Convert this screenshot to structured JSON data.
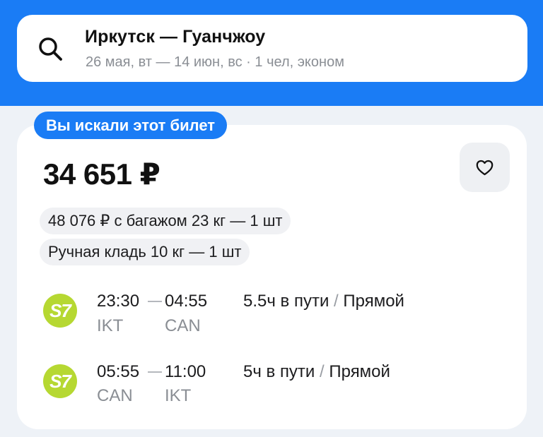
{
  "search": {
    "route": "Иркутск — Гуанчжоу",
    "details": "26 мая, вт — 14 июн, вс · 1 чел, эконом"
  },
  "ticket": {
    "badge": "Вы искали этот билет",
    "price": "34 651 ₽",
    "baggage_option": "48 076 ₽ с багажом 23 кг — 1 шт",
    "hand_luggage": "Ручная кладь 10 кг — 1 шт",
    "segments": [
      {
        "airline_logo": "S7",
        "depart_time": "23:30",
        "arrive_time": "04:55",
        "depart_code": "IKT",
        "arrive_code": "CAN",
        "duration": "5.5ч в пути",
        "separator": "/",
        "stops": "Прямой"
      },
      {
        "airline_logo": "S7",
        "depart_time": "05:55",
        "arrive_time": "11:00",
        "depart_code": "CAN",
        "arrive_code": "IKT",
        "duration": "5ч в пути",
        "separator": "/",
        "stops": "Прямой"
      }
    ]
  },
  "icons": {
    "search": "search-icon",
    "favorite": "heart-icon"
  },
  "colors": {
    "brand_blue": "#1a7cf5",
    "airline_green": "#b6d832",
    "background": "#eef2f7"
  }
}
